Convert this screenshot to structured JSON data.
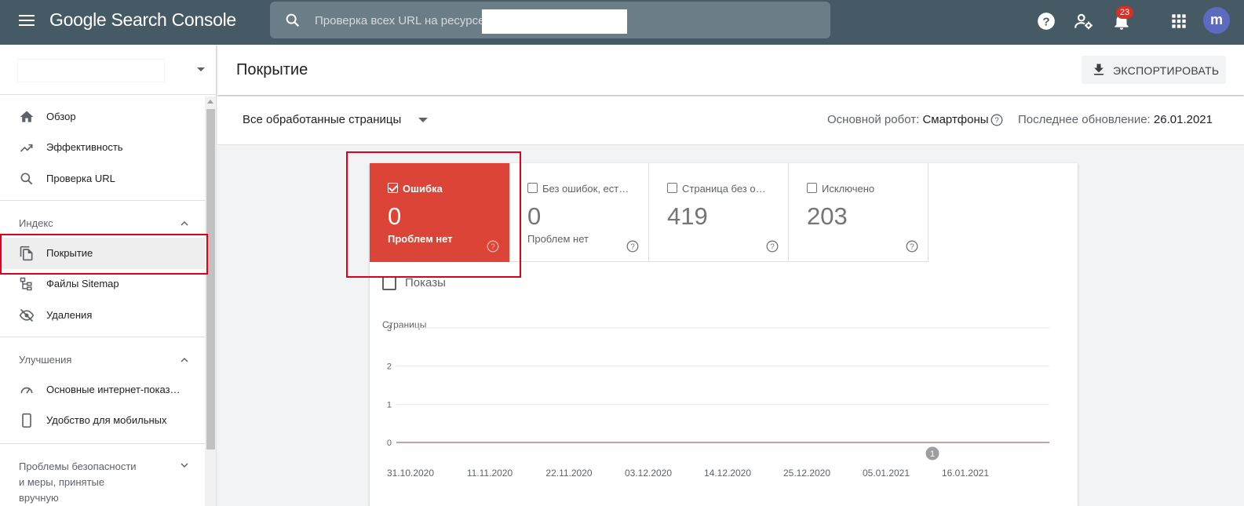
{
  "topbar": {
    "logo": "Google Search Console",
    "search_placeholder": "Проверка всех URL на ресурсе",
    "notification_count": "23",
    "avatar_letter": "m"
  },
  "sidebar": {
    "nav_top": [
      {
        "label": "Обзор",
        "icon": "home-icon"
      },
      {
        "label": "Эффективность",
        "icon": "trending-up-icon"
      },
      {
        "label": "Проверка URL",
        "icon": "search-icon"
      }
    ],
    "index_section": "Индекс",
    "index_items": [
      {
        "label": "Покрытие",
        "icon": "coverage-icon"
      },
      {
        "label": "Файлы Sitemap",
        "icon": "sitemap-icon"
      },
      {
        "label": "Удаления",
        "icon": "removals-icon"
      }
    ],
    "enhancements_section": "Улучшения",
    "enhancements_items": [
      {
        "label": "Основные интернет-показ…",
        "icon": "speed-icon"
      },
      {
        "label": "Удобство для мобильных",
        "icon": "smartphone-icon"
      }
    ],
    "security_section_lines": [
      "Проблемы безопасности",
      "и меры, принятые",
      "вручную"
    ]
  },
  "main": {
    "title": "Покрытие",
    "export_label": "ЭКСПОРТИРОВАТЬ",
    "filter_label": "Все обработанные страницы",
    "robot_label": "Основной робот:",
    "robot_value": "Смартфоны",
    "updated_label": "Последнее обновление:",
    "updated_value": "26.01.2021"
  },
  "tiles": [
    {
      "label": "Ошибка",
      "value": "0",
      "sub": "Проблем нет",
      "checked": true,
      "color": "#db4437"
    },
    {
      "label": "Без ошибок, ест…",
      "value": "0",
      "sub": "Проблем нет",
      "checked": false
    },
    {
      "label": "Страница без о…",
      "value": "419",
      "sub": "",
      "checked": false
    },
    {
      "label": "Исключено",
      "value": "203",
      "sub": "",
      "checked": false
    }
  ],
  "impressions_label": "Показы",
  "chart_data": {
    "type": "line",
    "ylabel": "Страницы",
    "ylim": [
      0,
      3
    ],
    "yticks": [
      "3",
      "2",
      "1",
      "0"
    ],
    "x": [
      "31.10.2020",
      "11.11.2020",
      "22.11.2020",
      "03.12.2020",
      "14.12.2020",
      "25.12.2020",
      "05.01.2021",
      "16.01.2021"
    ],
    "series": [
      {
        "values": [
          0,
          0,
          0,
          0,
          0,
          0,
          0,
          0
        ],
        "color": "#db4437"
      }
    ],
    "annotations": [
      {
        "label": "1",
        "x": "05.01.2021"
      }
    ],
    "grid": true
  }
}
